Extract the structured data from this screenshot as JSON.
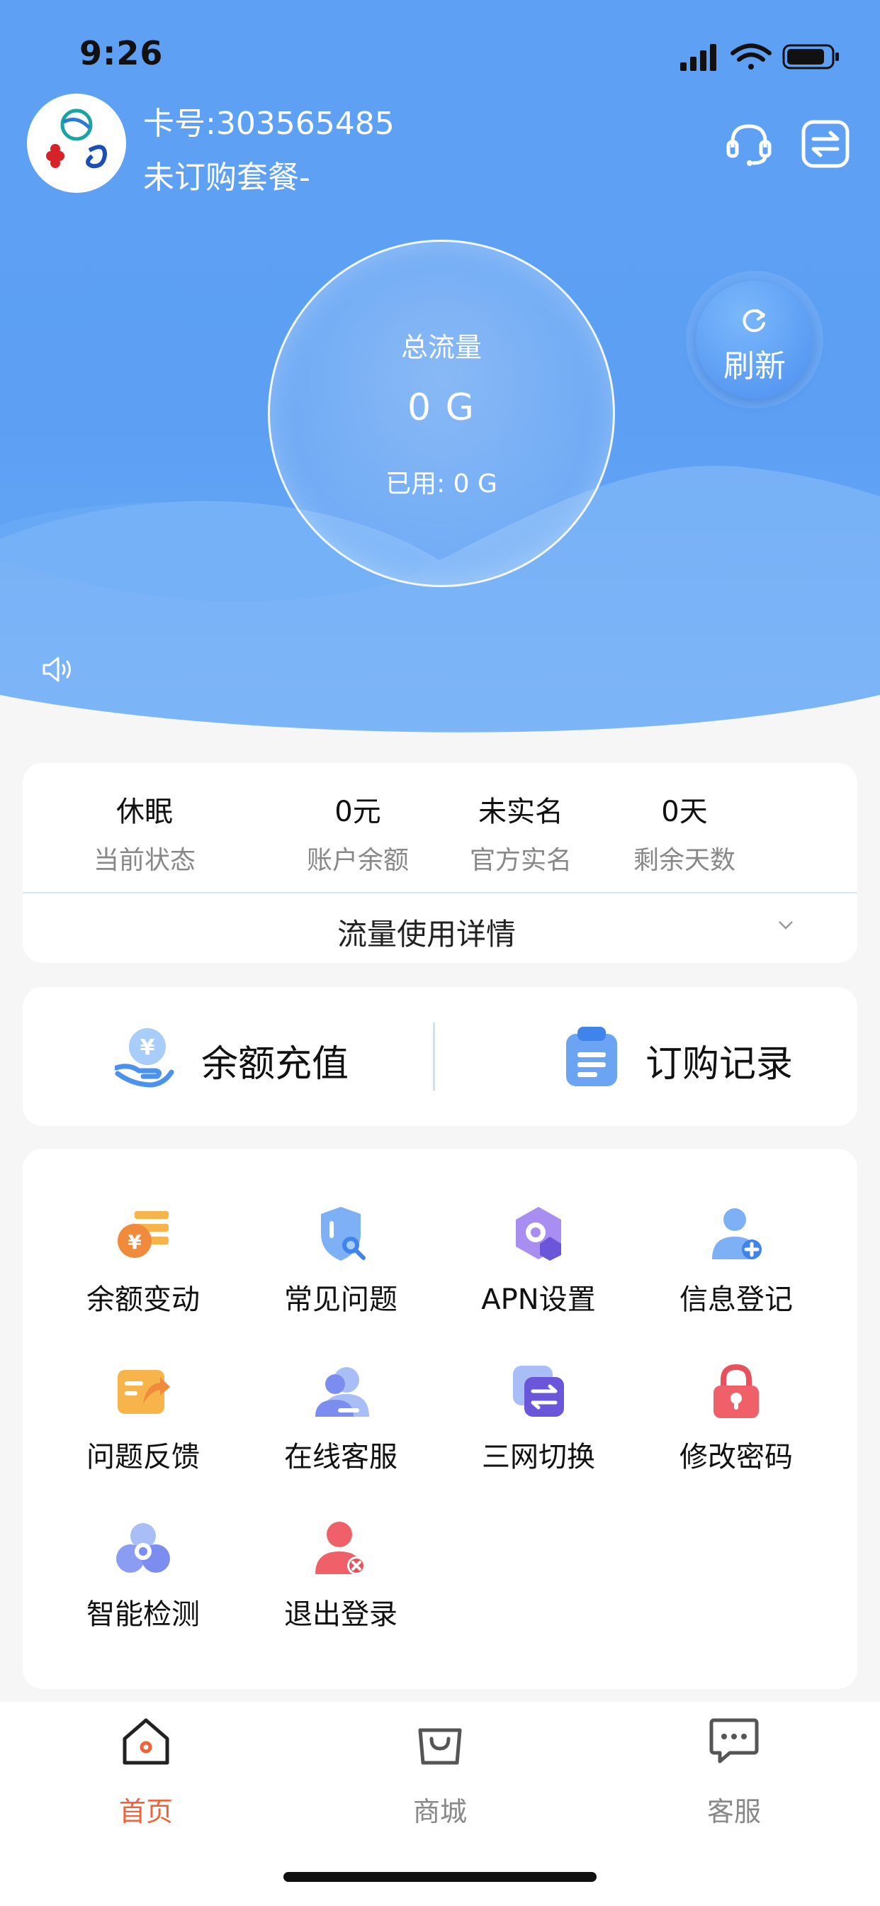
{
  "status_bar": {
    "time": "9:26"
  },
  "account": {
    "card_number": "卡号:303565485",
    "plan_status": "未订购套餐-"
  },
  "flow": {
    "title": "总流量",
    "total": "0 G",
    "used": "已用: 0 G"
  },
  "refresh": {
    "label": "刷新"
  },
  "stats": [
    {
      "value": "休眠",
      "label": "当前状态"
    },
    {
      "value": "0元",
      "label": "账户余额"
    },
    {
      "value": "未实名",
      "label": "官方实名"
    },
    {
      "value": "0天",
      "label": "剩余天数"
    }
  ],
  "detail": {
    "label": "流量使用详情"
  },
  "quick_actions": [
    {
      "label": "余额充值",
      "icon": "yuan-hand-icon"
    },
    {
      "label": "订购记录",
      "icon": "clipboard-icon"
    }
  ],
  "menu": [
    {
      "label": "余额变动",
      "icon": "coin-list-icon"
    },
    {
      "label": "常见问题",
      "icon": "shield-search-icon"
    },
    {
      "label": "APN设置",
      "icon": "hexagon-settings-icon"
    },
    {
      "label": "信息登记",
      "icon": "user-add-icon"
    },
    {
      "label": "问题反馈",
      "icon": "feedback-icon"
    },
    {
      "label": "在线客服",
      "icon": "agent-icon"
    },
    {
      "label": "三网切换",
      "icon": "network-switch-icon"
    },
    {
      "label": "修改密码",
      "icon": "lock-icon"
    },
    {
      "label": "智能检测",
      "icon": "detect-icon"
    },
    {
      "label": "退出登录",
      "icon": "user-logout-icon"
    }
  ],
  "tabs": [
    {
      "label": "首页",
      "icon": "home-icon",
      "active": true
    },
    {
      "label": "商城",
      "icon": "bag-icon",
      "active": false
    },
    {
      "label": "客服",
      "icon": "chat-icon",
      "active": false
    }
  ],
  "colors": {
    "header_blue": "#5ea1f4",
    "active_tab": "#f0623a",
    "inactive_tab": "#888888"
  }
}
